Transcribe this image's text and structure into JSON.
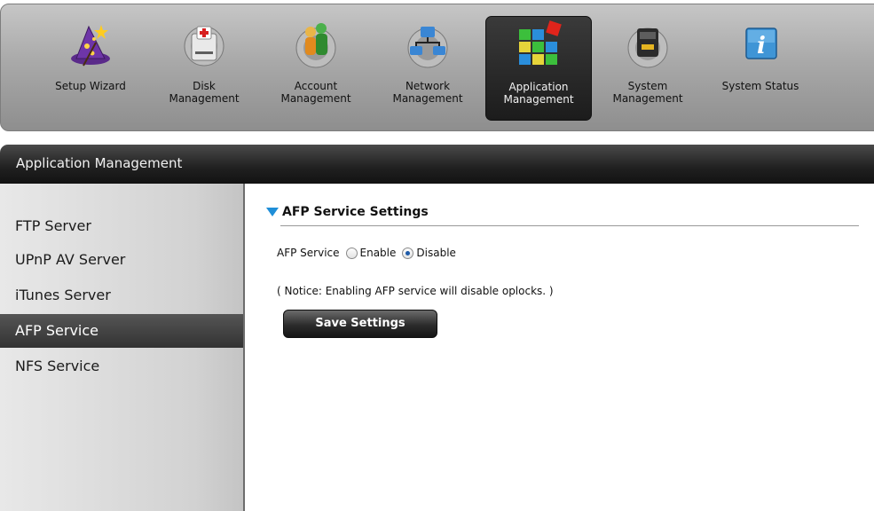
{
  "toolbar": {
    "items": [
      {
        "label": "Setup Wizard",
        "icon": "wizard-hat-icon",
        "active": false
      },
      {
        "label": "Disk\nManagement",
        "icon": "hard-disk-icon",
        "active": false
      },
      {
        "label": "Account\nManagement",
        "icon": "users-icon",
        "active": false
      },
      {
        "label": "Network\nManagement",
        "icon": "network-icon",
        "active": false
      },
      {
        "label": "Application\nManagement",
        "icon": "apps-grid-icon",
        "active": true
      },
      {
        "label": "System\nManagement",
        "icon": "system-gear-icon",
        "active": false
      },
      {
        "label": "System Status",
        "icon": "info-icon",
        "active": false
      }
    ]
  },
  "section": {
    "title": "Application Management"
  },
  "sidebar": {
    "items": [
      {
        "label": "FTP Server",
        "active": false
      },
      {
        "label": "UPnP AV Server",
        "active": false
      },
      {
        "label": "iTunes Server",
        "active": false
      },
      {
        "label": "AFP Service",
        "active": true
      },
      {
        "label": "NFS Service",
        "active": false
      }
    ]
  },
  "panel": {
    "title": "AFP Service Settings",
    "field_label": "AFP Service",
    "option_enable": "Enable",
    "option_disable": "Disable",
    "selected": "Disable",
    "notice": "( Notice: Enabling AFP service will disable oplocks. )",
    "save_label": "Save Settings"
  },
  "colors": {
    "accent": "#1f8ed8",
    "active_bg": "#333333"
  }
}
